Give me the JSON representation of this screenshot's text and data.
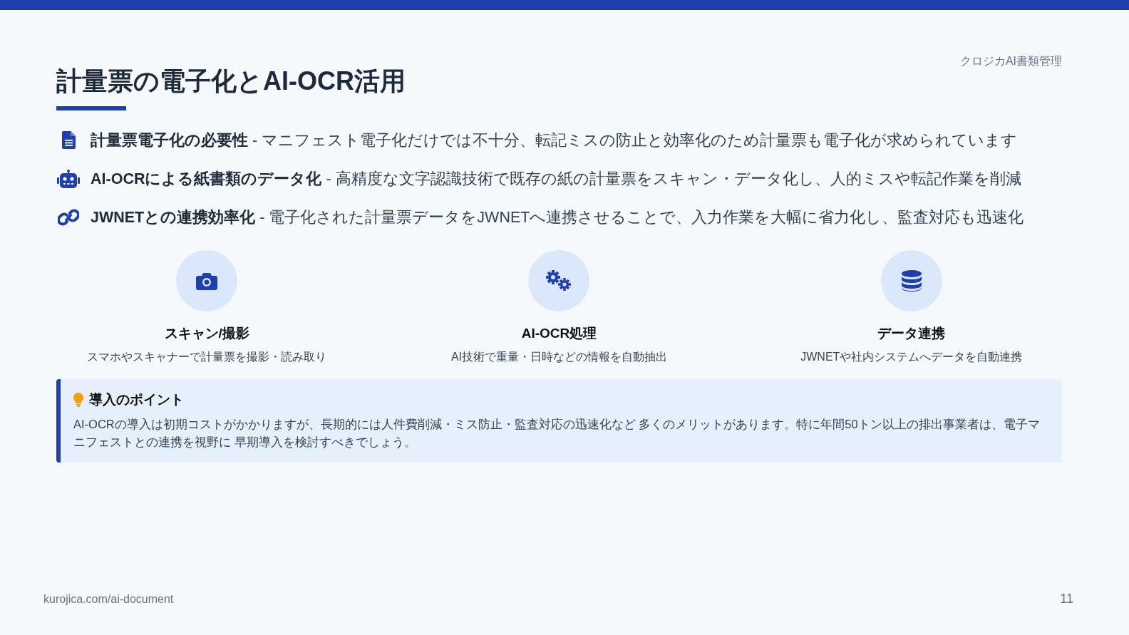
{
  "brand": "クロジカAI書類管理",
  "title": "計量票の電子化とAI-OCR活用",
  "points": [
    {
      "text": "**計量票電子化の必要性** - マニフェスト電子化だけでは不十分、転記ミスの防止と効率化のため計量票も電子化が求められています"
    },
    {
      "text": "**AI-OCRによる紙書類のデータ化** - 高精度な文字認識技術で既存の紙の計量票をスキャン・データ化し、人的ミスや転記作業を削減"
    },
    {
      "text": "**JWNETとの連携効率化** - 電子化された計量票データをJWNETへ連携させることで、入力作業を大幅に省力化し、監査対応も迅速化"
    }
  ],
  "steps": [
    {
      "title": "スキャン/撮影",
      "description": "スマホやスキャナーで計量票を撮影・読み取り"
    },
    {
      "title": "AI-OCR処理",
      "description": "AI技術で重量・日時などの情報を自動抽出"
    },
    {
      "title": "データ連携",
      "description": "JWNETや社内システムへデータを自動連携"
    }
  ],
  "tip": {
    "title": "導入のポイント",
    "text": "AI-OCRの導入は初期コストがかかりますが、長期的には人件費削減・ミス防止・監査対応の迅速化など 多くのメリットがあります。特に年間50トン以上の排出事業者は、電子マニフェストとの連携を視野に 早期導入を検討すべきでしょう。"
  },
  "footer": {
    "url": "kurojica.com/ai-document",
    "page": "11"
  }
}
